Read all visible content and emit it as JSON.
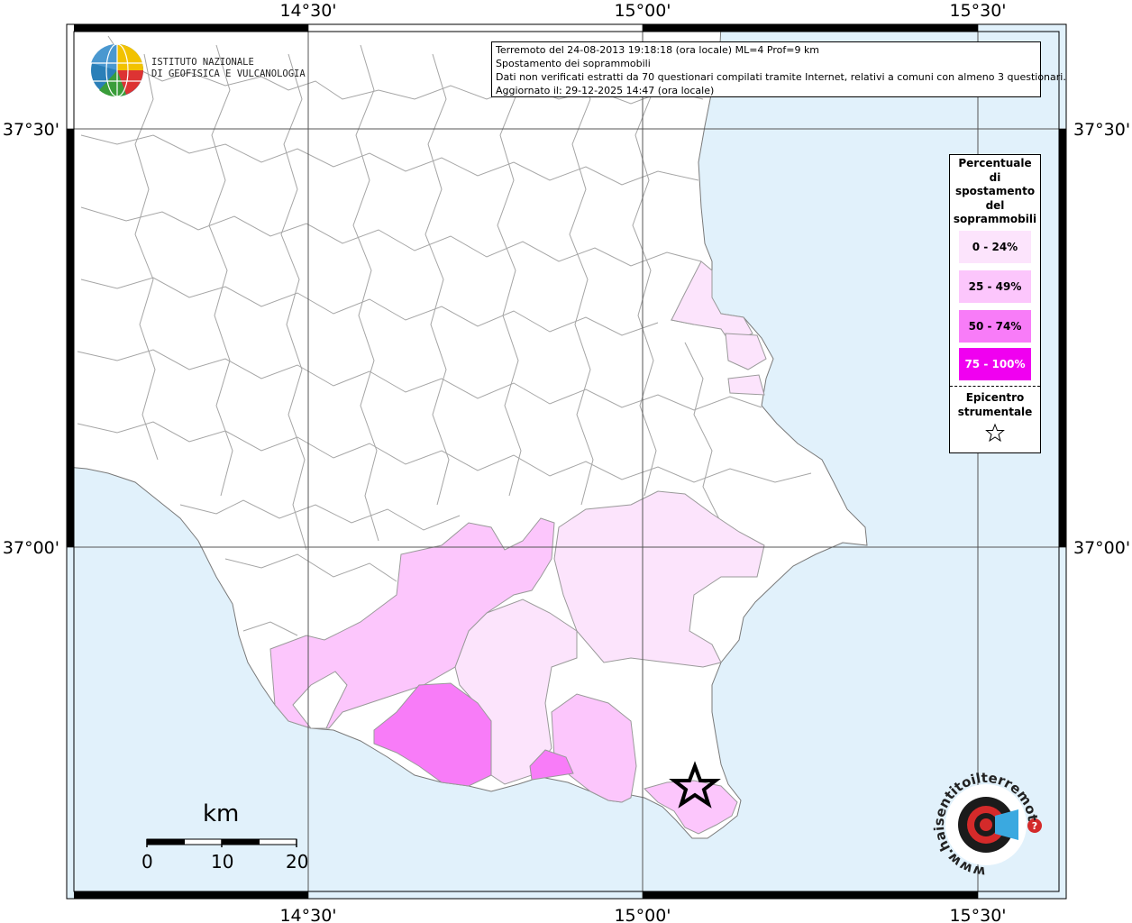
{
  "map": {
    "lon_ticks": [
      "14°30'",
      "15°00'",
      "15°30'"
    ],
    "lat_ticks": [
      "37°30'",
      "37°00'"
    ]
  },
  "info_box": {
    "line1": "Terremoto del 24-08-2013 19:18:18 (ora locale) ML=4 Prof=9 km",
    "line2": "Spostamento dei soprammobili",
    "line3": "Dati non verificati estratti da 70 questionari compilati tramite Internet, relativi a comuni con almeno 3 questionari.",
    "line4": "Aggiornato il: 29-12-2025 14:47 (ora locale)"
  },
  "logo": {
    "line1": "ISTITUTO NAZIONALE",
    "line2": "DI GEOFISICA E VULCANOLOGIA"
  },
  "legend": {
    "title_lines": [
      "Percentuale",
      "di",
      "spostamento",
      "del",
      "soprammobili"
    ],
    "classes": [
      {
        "label": "0 - 24%",
        "color": "#fce4fc",
        "text_color": "#000000"
      },
      {
        "label": "25 - 49%",
        "color": "#fcc6fc",
        "text_color": "#000000"
      },
      {
        "label": "50 - 74%",
        "color": "#f87cf8",
        "text_color": "#000000"
      },
      {
        "label": "75 - 100%",
        "color": "#f000f0",
        "text_color": "#ffffff"
      }
    ],
    "epicenter_lines": [
      "Epicentro",
      "strumentale"
    ]
  },
  "scale_bar": {
    "unit": "km",
    "labels": [
      "0",
      "10",
      "20"
    ]
  },
  "watermark": {
    "text": "www.haisentitoilterremoto.it"
  },
  "colors": {
    "sea": "#e1f1fb",
    "land": "#ffffff",
    "border_line": "#9a9a9a",
    "grid": "#555555"
  }
}
